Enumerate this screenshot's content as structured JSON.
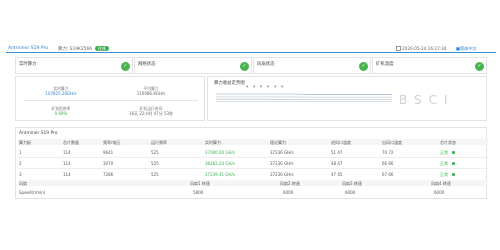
{
  "header": {
    "brand": "Antminer S19 Pro",
    "model_label": "算力: S19K2566",
    "status": "在线",
    "timestamp": "2020-05-24 16:27:34",
    "language": "■简体中文"
  },
  "summary_cards": [
    {
      "label": "实时算力",
      "icon": "ok-circle-icon"
    },
    {
      "label": "网络状态",
      "icon": "ok-circle-icon"
    },
    {
      "label": "风扇状态",
      "icon": "ok-circle-icon"
    },
    {
      "label": "矿机温度",
      "icon": "ok-circle-icon"
    }
  ],
  "stats": [
    {
      "label": "实时算力",
      "value": "107825.20GH/s",
      "color": "#2b7fd0"
    },
    {
      "label": "平均算力",
      "value": "110086.8GH/s",
      "color": "#666666"
    },
    {
      "label": "矿池拒绝率",
      "value": "0.69%",
      "color": "#3cb04b"
    },
    {
      "label": "矿机运行时间",
      "value": "16天 22小时 47分 53秒",
      "color": "#666666"
    }
  ],
  "hash_chart": {
    "title": "算力收益走势图",
    "legend": "■ ■ ■ ■ ■ ■",
    "watermark": "BSCI",
    "chart_data": {
      "type": "line",
      "title": "算力收益走势图",
      "series": [
        {
          "values": [
            0.78,
            0.78,
            0.78,
            0.78,
            0.77,
            0.77,
            0.77,
            0.77
          ]
        },
        {
          "values": [
            0.69,
            0.69,
            0.69,
            0.69,
            0.68,
            0.68,
            0.68,
            0.68
          ]
        },
        {
          "values": [
            0.62,
            0.62,
            0.62,
            0.61,
            0.61,
            0.61,
            0.61,
            0.61
          ]
        },
        {
          "values": [
            0.55,
            0.55,
            0.55,
            0.55,
            0.54,
            0.54,
            0.54,
            0.54
          ]
        }
      ],
      "ylim": [
        0,
        1
      ]
    }
  },
  "board_section": {
    "title": "Antminer S19 Pro",
    "columns": [
      "算力板",
      "芯片数量",
      "频率/电压",
      "运行频率",
      "实时算力",
      "理论算力",
      "进风口温度",
      "出风口温度",
      "芯片状态"
    ],
    "rows": [
      {
        "board": "1",
        "chips": "114",
        "freq_v": "9641",
        "run": "525",
        "realtime": "37000.00 GH/s",
        "theory": "37236 GH/s",
        "in_temp": "51 47",
        "out_temp": "70 72",
        "state": "正常"
      },
      {
        "board": "2",
        "chips": "114",
        "freq_v": "3070",
        "run": "525",
        "realtime": "36482.24 GH/s",
        "theory": "37236 GH/s",
        "in_temp": "48 47",
        "out_temp": "66 66",
        "state": "正常"
      },
      {
        "board": "3",
        "chips": "114",
        "freq_v": "7286",
        "run": "525",
        "realtime": "37239.41 GH/s",
        "theory": "37236 GH/s",
        "in_temp": "47 45",
        "out_temp": "67 66",
        "state": "正常"
      }
    ]
  },
  "fan_section": {
    "label": "风扇",
    "speed_label": "Speed(r/min)",
    "fans": [
      {
        "name": "风扇1 转速",
        "speed": "5800"
      },
      {
        "name": "风扇2 转速",
        "speed": "6000"
      },
      {
        "name": "风扇3 转速",
        "speed": "6000"
      },
      {
        "name": "风扇4 转速",
        "speed": "6000"
      }
    ]
  }
}
